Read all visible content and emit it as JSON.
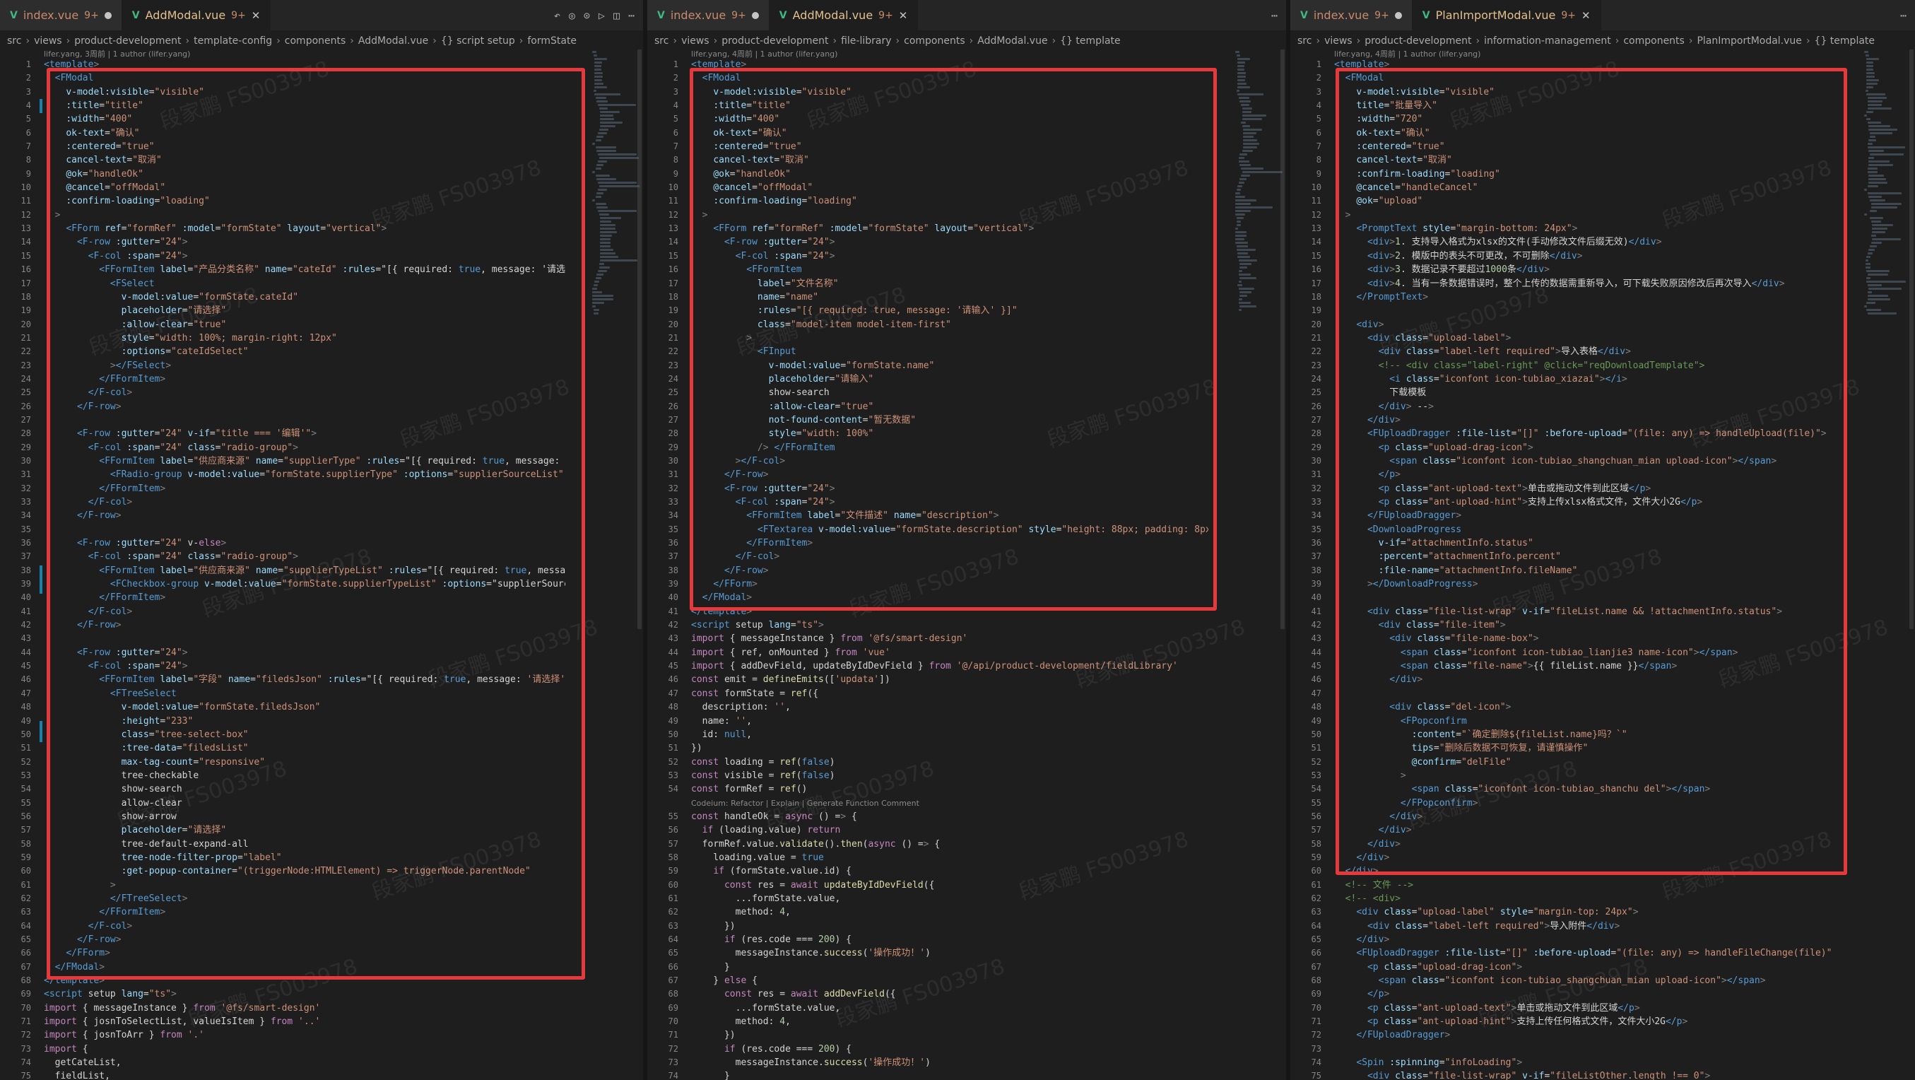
{
  "watermark": "段家鹏 FS003978",
  "colors": {
    "highlight_box": "#e5393b",
    "editor_bg": "#1e1e1e"
  },
  "panes": [
    {
      "tabs": [
        {
          "label": "index.vue",
          "badge": "9+",
          "state": "dot",
          "active": false
        },
        {
          "label": "AddModal.vue",
          "badge": "9+",
          "state": "close",
          "active": true
        }
      ],
      "breadcrumb": [
        "src",
        "views",
        "product-development",
        "template-config",
        "components",
        "AddModal.vue",
        "{} script setup",
        "formState"
      ],
      "blame": "lifer.yang, 3周前 | 1 author (lifer.yang)",
      "start_line": 1,
      "lines": [
        "<template>",
        "  <FModal",
        "    v-model:visible=\"visible\"",
        "    :title=\"title\"",
        "    :width=\"400\"",
        "    ok-text=\"确认\"",
        "    :centered=\"true\"",
        "    cancel-text=\"取消\"",
        "    @ok=\"handleOk\"",
        "    @cancel=\"offModal\"",
        "    :confirm-loading=\"loading\"",
        "  >",
        "    <FForm ref=\"formRef\" :model=\"formState\" layout=\"vertical\">",
        "      <F-row :gutter=\"24\">",
        "        <F-col :span=\"24\">",
        "          <FFormItem label=\"产品分类名称\" name=\"cateId\" :rules=\"[{ required: true, message: '请选择",
        "            <FSelect",
        "              v-model:value=\"formState.cateId\"",
        "              placeholder=\"请选择\"",
        "              :allow-clear=\"true\"",
        "              style=\"width: 100%; margin-right: 12px\"",
        "              :options=\"cateIdSelect\"",
        "            ></FSelect>",
        "          </FFormItem>",
        "        </F-col>",
        "      </F-row>",
        "",
        "      <F-row :gutter=\"24\" v-if=\"title === '编辑'\">",
        "        <F-col :span=\"24\" class=\"radio-group\">",
        "          <FFormItem label=\"供应商来源\" name=\"supplierType\" :rules=\"[{ required: true, message: '",
        "            <FRadio-group v-model:value=\"formState.supplierType\" :options=\"supplierSourceList\"",
        "          </FFormItem>",
        "        </F-col>",
        "      </F-row>",
        "",
        "      <F-row :gutter=\"24\" v-else>",
        "        <F-col :span=\"24\" class=\"radio-group\">",
        "          <FFormItem label=\"供应商来源\" name=\"supplierTypeList\" :rules=\"[{ required: true, messag",
        "            <FCheckbox-group v-model:value=\"formState.supplierTypeList\" :options=\"supplierSourc",
        "          </FFormItem>",
        "        </F-col>",
        "      </F-row>",
        "",
        "      <F-row :gutter=\"24\">",
        "        <F-col :span=\"24\">",
        "          <FFormItem label=\"字段\" name=\"filedsJson\" :rules=\"[{ required: true, message: '请选择'",
        "            <FTreeSelect",
        "              v-model:value=\"formState.filedsJson\"",
        "              :height=\"233\"",
        "              class=\"tree-select-box\"",
        "              :tree-data=\"filedsList\"",
        "              max-tag-count=\"responsive\"",
        "              tree-checkable",
        "              show-search",
        "              allow-clear",
        "              show-arrow",
        "              placeholder=\"请选择\"",
        "              tree-default-expand-all",
        "              tree-node-filter-prop=\"label\"",
        "              :get-popup-container=\"(triggerNode:HTMLElement) => triggerNode.parentNode\"",
        "            >",
        "            </FTreeSelect>",
        "          </FFormItem>",
        "        </F-col>",
        "      </F-row>",
        "    </FForm>",
        "  </FModal>",
        "</template>",
        "<script setup lang=\"ts\">",
        "import { messageInstance } from '@fs/smart-design'",
        "import { josnToSelectList, valueIsItem } from '..'",
        "import { josnToArr } from '.'",
        "import {",
        "  getCateList,",
        "  fieldList,"
      ]
    },
    {
      "tabs": [
        {
          "label": "index.vue",
          "badge": "9+",
          "state": "dot",
          "active": false
        },
        {
          "label": "AddModal.vue",
          "badge": "9+",
          "state": "close",
          "active": true
        }
      ],
      "breadcrumb": [
        "src",
        "views",
        "product-development",
        "file-library",
        "components",
        "AddModal.vue",
        "{} template"
      ],
      "blame": "lifer.yang, 4周前 | 1 author (lifer.yang)",
      "codelens": "Codeium: Refactor | Explain | Generate Function Comment",
      "start_line": 1,
      "lines": [
        "<template>",
        "  <FModal",
        "    v-model:visible=\"visible\"",
        "    :title=\"title\"",
        "    :width=\"400\"",
        "    ok-text=\"确认\"",
        "    :centered=\"true\"",
        "    cancel-text=\"取消\"",
        "    @ok=\"handleOk\"",
        "    @cancel=\"offModal\"",
        "    :confirm-loading=\"loading\"",
        "  >",
        "    <FForm ref=\"formRef\" :model=\"formState\" layout=\"vertical\">",
        "      <F-row :gutter=\"24\">",
        "        <F-col :span=\"24\">",
        "          <FFormItem",
        "            label=\"文件名称\"",
        "            name=\"name\"",
        "            :rules=\"[{ required: true, message: '请输入' }]\"",
        "            class=\"model-item model-item-first\"",
        "          >",
        "            <FInput",
        "              v-model:value=\"formState.name\"",
        "              placeholder=\"请输入\"",
        "              show-search",
        "              :allow-clear=\"true\"",
        "              not-found-content=\"暂无数据\"",
        "              style=\"width: 100%\"",
        "            /> </FFormItem",
        "        ></F-col>",
        "      </F-row>",
        "      <F-row :gutter=\"24\">",
        "        <F-col :span=\"24\">",
        "          <FFormItem label=\"文件描述\" name=\"description\">",
        "            <FTextarea v-model:value=\"formState.description\" style=\"height: 88px; padding: 8px\"",
        "          </FFormItem>",
        "        </F-col>",
        "      </F-row>",
        "    </FForm>",
        "  </FModal>",
        "</template>",
        "<script setup lang=\"ts\">",
        "import { messageInstance } from '@fs/smart-design'",
        "import { ref, onMounted } from 'vue'",
        "import { addDevField, updateByIdDevField } from '@/api/product-development/fieldLibrary'",
        "const emit = defineEmits(['updata'])",
        "const formState = ref({",
        "  description: '',",
        "  name: '',",
        "  id: null,",
        "})",
        "const loading = ref(false)",
        "const visible = ref(false)",
        "const formRef = ref()",
        "const handleOk = async () => {",
        "  if (loading.value) return",
        "  formRef.value.validate().then(async () => {",
        "    loading.value = true",
        "    if (formState.value.id) {",
        "      const res = await updateByIdDevField({",
        "        ...formState.value,",
        "        method: 4,",
        "      })",
        "      if (res.code === 200) {",
        "        messageInstance.success('操作成功！')",
        "      }",
        "    } else {",
        "      const res = await addDevField({",
        "        ...formState.value,",
        "        method: 4,",
        "      })",
        "      if (res.code === 200) {",
        "        messageInstance.success('操作成功！')",
        "      }"
      ]
    },
    {
      "tabs": [
        {
          "label": "index.vue",
          "badge": "9+",
          "state": "dot",
          "active": false
        },
        {
          "label": "PlanImportModal.vue",
          "badge": "9+",
          "state": "close",
          "active": true
        }
      ],
      "breadcrumb": [
        "src",
        "views",
        "product-development",
        "information-management",
        "components",
        "PlanImportModal.vue",
        "{} template"
      ],
      "blame": "lifer.yang, 4周前 | 1 author (lifer.yang)",
      "start_line": 1,
      "lines": [
        "<template>",
        "  <FModal",
        "    v-model:visible=\"visible\"",
        "    title=\"批量导入\"",
        "    :width=\"720\"",
        "    ok-text=\"确认\"",
        "    :centered=\"true\"",
        "    cancel-text=\"取消\"",
        "    :confirm-loading=\"loading\"",
        "    @cancel=\"handleCancel\"",
        "    @ok=\"upload\"",
        "  >",
        "    <PromptText style=\"margin-bottom: 24px\">",
        "      <div>1. 支持导入格式为xlsx的文件(手动修改文件后缀无效)</div>",
        "      <div>2. 模版中的表头不可更改，不可删除</div>",
        "      <div>3. 数据记录不要超过1000条</div>",
        "      <div>4. 当有一条数据错误时，整个上传的数据需重新导入，可下载失败原因修改后再次导入</div>",
        "    </PromptText>",
        "",
        "    <div>",
        "      <div class=\"upload-label\">",
        "        <div class=\"label-left required\">导入表格</div>",
        "        <!-- <div class=\"label-right\" @click=\"reqDownloadTemplate\">",
        "          <i class=\"iconfont icon-tubiao_xiazai\"></i>",
        "          下载模板",
        "        </div> -->",
        "      </div>",
        "      <FUploadDragger :file-list=\"[]\" :before-upload=\"(file: any) => handleUpload(file)\">",
        "        <p class=\"upload-drag-icon\">",
        "          <span class=\"iconfont icon-tubiao_shangchuan_mian upload-icon\"></span>",
        "        </p>",
        "        <p class=\"ant-upload-text\">单击或拖动文件到此区域</p>",
        "        <p class=\"ant-upload-hint\">支持上传xlsx格式文件，文件大小2G</p>",
        "      </FUploadDragger>",
        "      <DownloadProgress",
        "        v-if=\"attachmentInfo.status\"",
        "        :percent=\"attachmentInfo.percent\"",
        "        :file-name=\"attachmentInfo.fileName\"",
        "      ></DownloadProgress>",
        "",
        "      <div class=\"file-list-wrap\" v-if=\"fileList.name && !attachmentInfo.status\">",
        "        <div class=\"file-item\">",
        "          <div class=\"file-name-box\">",
        "            <span class=\"iconfont icon-tubiao_lianjie3 name-icon\"></span>",
        "            <span class=\"file-name\">{{ fileList.name }}</span>",
        "          </div>",
        "",
        "          <div class=\"del-icon\">",
        "            <FPopconfirm",
        "              :content=\"`确定删除${fileList.name}吗？`\"",
        "              tips=\"删除后数据不可恢复，请谨慎操作\"",
        "              @confirm=\"delFile\"",
        "            >",
        "              <span class=\"iconfont icon-tubiao_shanchu del\"></span>",
        "            </FPopconfirm>",
        "          </div>",
        "        </div>",
        "      </div>",
        "    </div>",
        "  </div>",
        "  <!-- 文件 -->",
        "  <!-- <div>",
        "    <div class=\"upload-label\" style=\"margin-top: 24px\">",
        "      <div class=\"label-left required\">导入附件</div>",
        "    </div>",
        "    <FUploadDragger :file-list=\"[]\" :before-upload=\"(file: any) => handleFileChange(file)\" :m",
        "      <p class=\"upload-drag-icon\">",
        "        <span class=\"iconfont icon-tubiao_shangchuan_mian upload-icon\"></span>",
        "      </p>",
        "      <p class=\"ant-upload-text\">单击或拖动文件到此区域</p>",
        "      <p class=\"ant-upload-hint\">支持上传任何格式文件，文件大小2G</p>",
        "    </FUploadDragger>",
        "",
        "    <Spin :spinning=\"infoLoading\">",
        "      <div class=\"file-list-wrap\" v-if=\"fileListOther.length !== 0\">"
      ]
    }
  ]
}
